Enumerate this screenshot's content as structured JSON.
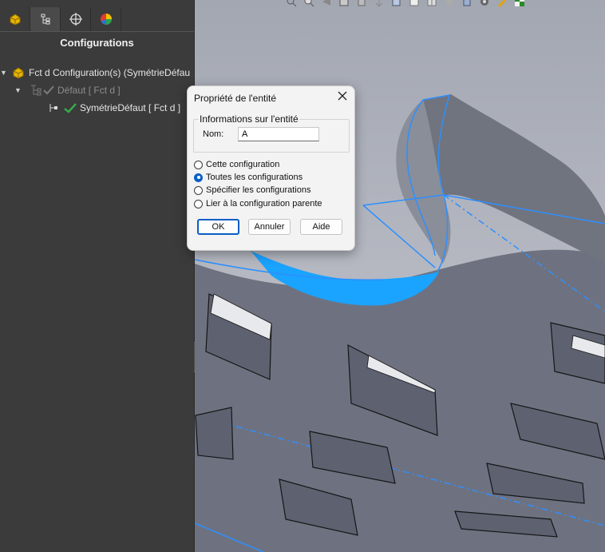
{
  "panel": {
    "title": "Configurations",
    "tabs": [
      {
        "name": "feature-manager-icon"
      },
      {
        "name": "property-manager-icon"
      },
      {
        "name": "configuration-manager-icon"
      },
      {
        "name": "display-manager-icon"
      }
    ],
    "tree": {
      "root_label": "Fct d Configuration(s)  (SymétrieDéfau",
      "child_label": "Défaut [ Fct d ]",
      "grandchild_label": "SymétrieDéfaut [ Fct d ]"
    }
  },
  "dialog": {
    "title": "Propriété de l'entité",
    "group_label": "Informations sur l'entité",
    "name_label": "Nom:",
    "name_value": "A",
    "options": [
      {
        "label": "Cette configuration",
        "checked": false
      },
      {
        "label": "Toutes les configurations",
        "checked": true
      },
      {
        "label": "Spécifier les configurations",
        "checked": false
      },
      {
        "label": "Lier à la configuration parente",
        "checked": false
      }
    ],
    "ok_label": "OK",
    "cancel_label": "Annuler",
    "help_label": "Aide"
  },
  "colors": {
    "selection": "#1aa3ff",
    "accent": "#0a5fc5",
    "model_face": "#6e7280"
  }
}
